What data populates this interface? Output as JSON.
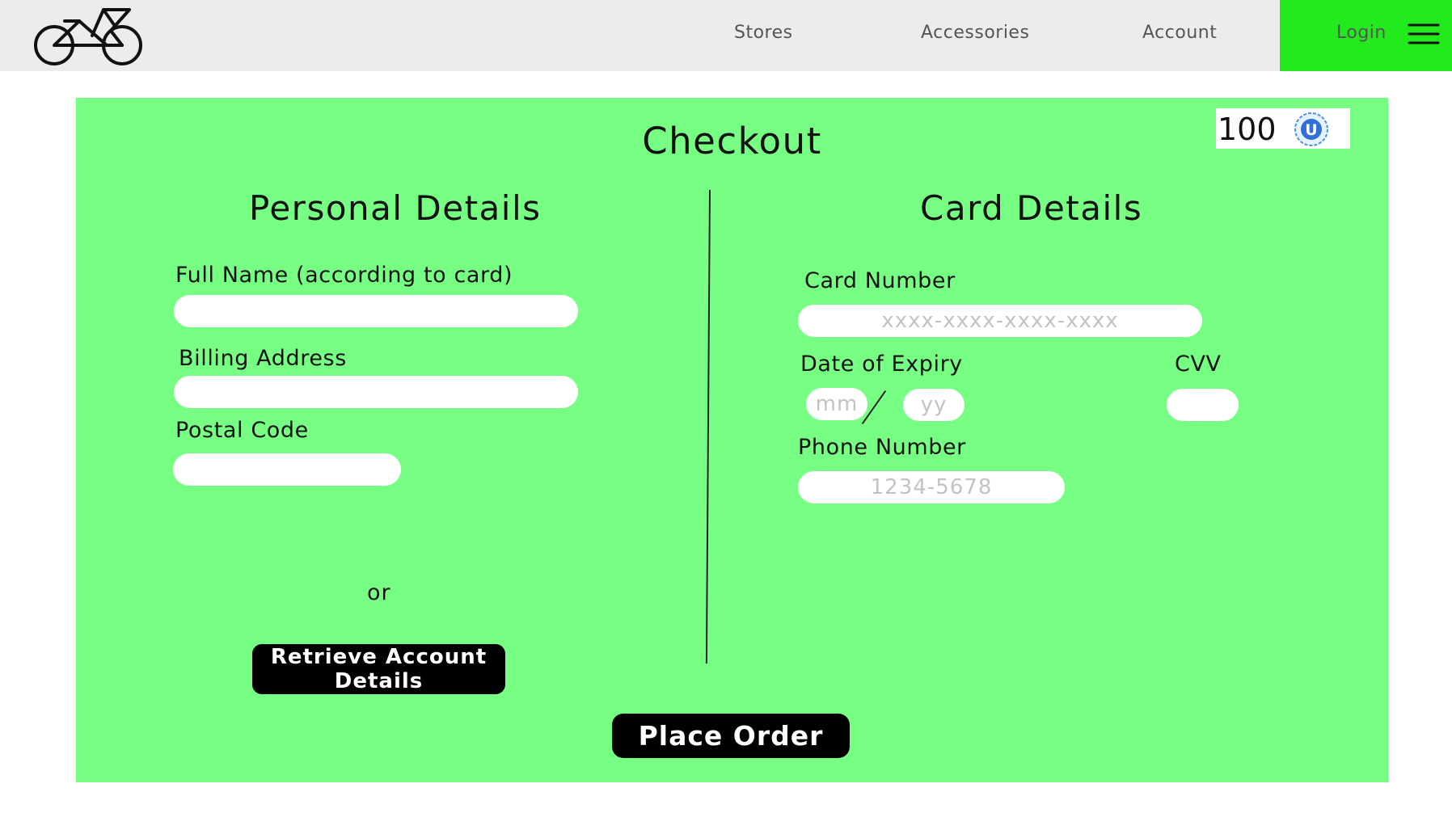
{
  "nav": {
    "logo_icon": "bicycle-icon",
    "links": [
      "Stores",
      "Accessories",
      "Account"
    ],
    "login_label": "Login",
    "menu_icon": "hamburger-menu-icon",
    "login_bg_color": "#22ea1c"
  },
  "checkout": {
    "title": "Checkout",
    "coins": "100",
    "coin_icon": "u-coin-icon",
    "bg_color": "#76ff83",
    "personal": {
      "title": "Personal Details",
      "full_name_label": "Full Name (according to card)",
      "full_name_value": "",
      "billing_label": "Billing Address",
      "billing_value": "",
      "postal_label": "Postal Code",
      "postal_value": "",
      "or_text": "or",
      "retrieve_line1": "Retrieve Account",
      "retrieve_line2": "Details"
    },
    "card": {
      "title": "Card Details",
      "card_number_label": "Card Number",
      "card_number_placeholder": "xxxx-xxxx-xxxx-xxxx",
      "expiry_label": "Date of Expiry",
      "month_placeholder": "mm",
      "year_placeholder": "yy",
      "cvv_label": "CVV",
      "cvv_value": "",
      "phone_label": "Phone Number",
      "phone_placeholder": "1234-5678"
    },
    "place_order_label": "Place Order"
  }
}
